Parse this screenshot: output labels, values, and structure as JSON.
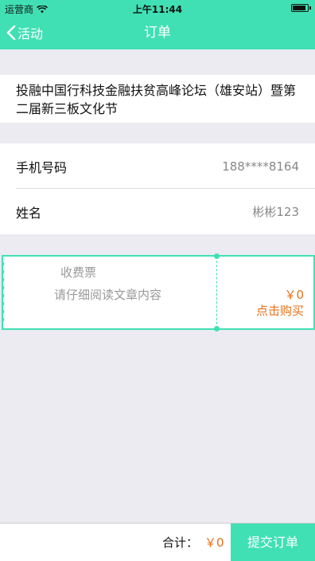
{
  "status_bar": {
    "carrier": "运营商",
    "time": "上午11:44"
  },
  "nav": {
    "back_label": "活动",
    "title": "订单"
  },
  "event": {
    "title": "投融中国行科技金融扶贫高峰论坛（雄安站）暨第二届新三板文化节"
  },
  "info": {
    "phone_label": "手机号码",
    "phone_value": "188****8164",
    "name_label": "姓名",
    "name_value": "彬彬123"
  },
  "ticket": {
    "name": "收费票",
    "description": "请仔细阅读文章内容",
    "price": "￥0",
    "buy_label": "点击购买"
  },
  "footer": {
    "total_label": "合计：",
    "total_value": "￥0",
    "submit_label": "提交订单"
  },
  "colors": {
    "accent": "#40e0b4",
    "price": "#e8711a",
    "background": "#ebebf1"
  }
}
